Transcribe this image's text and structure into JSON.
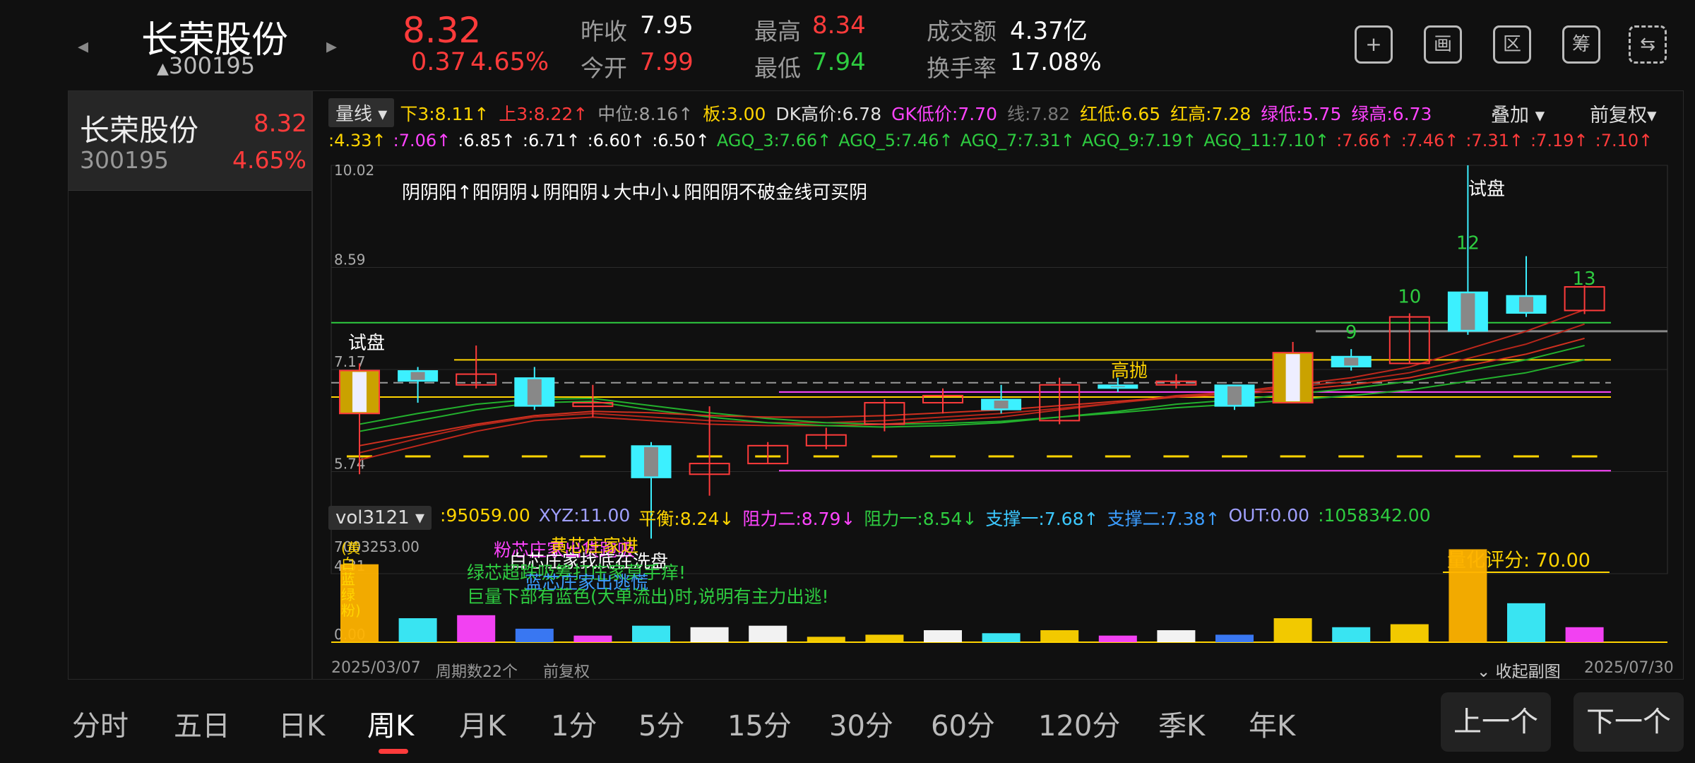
{
  "header": {
    "stock_name": "长荣股份",
    "stock_code": "300195",
    "price": "8.32",
    "change": "0.37",
    "change_pct": "4.65%",
    "prev_close_label": "昨收",
    "prev_close": "7.95",
    "open_label": "今开",
    "open": "7.99",
    "high_label": "最高",
    "high": "8.34",
    "low_label": "最低",
    "low": "7.94",
    "turnover_amt_label": "成交额",
    "turnover_amt": "4.37亿",
    "turnover_rate_label": "换手率",
    "turnover_rate": "17.08%",
    "tools": [
      {
        "icon": "plus-icon",
        "glyph": "+"
      },
      {
        "icon": "draw-icon",
        "glyph": "画"
      },
      {
        "icon": "range-icon",
        "glyph": "区"
      },
      {
        "icon": "chip-icon",
        "glyph": "筹"
      },
      {
        "icon": "landscape-icon",
        "glyph": "⇆"
      }
    ]
  },
  "side": {
    "name": "长荣股份",
    "price": "8.32",
    "code": "300195",
    "pct": "4.65%"
  },
  "indicator1": {
    "dropdown": "量线",
    "items": [
      {
        "text": "下3:8.11↑",
        "color": "#ffd400"
      },
      {
        "text": "上3:8.22↑",
        "color": "#ff3b3b"
      },
      {
        "text": "中位:8.16↑",
        "color": "#a0a0a0"
      },
      {
        "text": "板:3.00",
        "color": "#ffd400"
      },
      {
        "text": "DK高价:6.78",
        "color": "#e0e0e0"
      },
      {
        "text": "GK低价:7.70",
        "color": "#ff44ff"
      },
      {
        "text": "线:7.82",
        "color": "#777777"
      },
      {
        "text": "红低:6.65",
        "color": "#ffd400"
      },
      {
        "text": "红高:7.28",
        "color": "#ffd400"
      },
      {
        "text": "绿低:5.75",
        "color": "#ff44ff"
      },
      {
        "text": "绿高:6.73",
        "color": "#ff44ff"
      }
    ],
    "overlay": "叠加",
    "adjust": "前复权"
  },
  "indicator2": [
    {
      "text": ":4.33↑",
      "color": "#ffd400"
    },
    {
      "text": ":7.06↑",
      "color": "#ff44ff"
    },
    {
      "text": ":6.85↑",
      "color": "#ffffff"
    },
    {
      "text": ":6.71↑",
      "color": "#ffffff"
    },
    {
      "text": ":6.60↑",
      "color": "#ffffff"
    },
    {
      "text": ":6.50↑",
      "color": "#ffffff"
    },
    {
      "text": "AGQ_3:7.66↑",
      "color": "#2ecc40"
    },
    {
      "text": "AGQ_5:7.46↑",
      "color": "#2ecc40"
    },
    {
      "text": "AGQ_7:7.31↑",
      "color": "#2ecc40"
    },
    {
      "text": "AGQ_9:7.19↑",
      "color": "#2ecc40"
    },
    {
      "text": "AGQ_11:7.10↑",
      "color": "#2ecc40"
    },
    {
      "text": ":7.66↑",
      "color": "#ff3b3b"
    },
    {
      "text": ":7.46↑",
      "color": "#ff3b3b"
    },
    {
      "text": ":7.31↑",
      "color": "#ff3b3b"
    },
    {
      "text": ":7.19↑",
      "color": "#ff3b3b"
    },
    {
      "text": ":7.10↑",
      "color": "#ff3b3b"
    }
  ],
  "main_chart": {
    "y_ticks": [
      "10.02",
      "8.59",
      "7.17",
      "5.74",
      "4.31"
    ],
    "pattern_note": "阴阴阳↑阳阴阴↓阴阳阴↓大中小↓阳阳阴不破金线可买阴",
    "label_trial_left": "试盘",
    "label_trial_right": "试盘",
    "label_high_sell": "高抛",
    "numbers": [
      "9",
      "10",
      "12",
      "13"
    ],
    "score": "量化评分: 70.00",
    "colors": {
      "up": "#ff3b3b",
      "down": "#3cf0ff",
      "ma_red": "#c0281c",
      "ma_green": "#23b12d",
      "gold": "#ffd400",
      "magenta": "#ff44ff"
    }
  },
  "chart_data": {
    "type": "candlestick",
    "period": "周K",
    "x_start": "2025/03/07",
    "x_end": "2025/07/30",
    "ylim": [
      4.31,
      10.02
    ],
    "candles": [
      {
        "o": 6.55,
        "c": 7.15,
        "h": 7.25,
        "l": 5.7
      },
      {
        "o": 7.15,
        "c": 7.0,
        "h": 7.2,
        "l": 6.7
      },
      {
        "o": 6.95,
        "c": 7.1,
        "h": 7.5,
        "l": 6.9
      },
      {
        "o": 7.05,
        "c": 6.65,
        "h": 7.2,
        "l": 6.6
      },
      {
        "o": 6.65,
        "c": 6.7,
        "h": 6.95,
        "l": 6.5
      },
      {
        "o": 6.1,
        "c": 5.65,
        "h": 6.15,
        "l": 4.8
      },
      {
        "o": 5.7,
        "c": 5.85,
        "h": 6.65,
        "l": 5.4
      },
      {
        "o": 5.85,
        "c": 6.1,
        "h": 6.15,
        "l": 5.85
      },
      {
        "o": 6.1,
        "c": 6.25,
        "h": 6.35,
        "l": 6.05
      },
      {
        "o": 6.4,
        "c": 6.7,
        "h": 6.75,
        "l": 6.3
      },
      {
        "o": 6.7,
        "c": 6.8,
        "h": 6.9,
        "l": 6.55
      },
      {
        "o": 6.75,
        "c": 6.6,
        "h": 6.95,
        "l": 6.55
      },
      {
        "o": 6.45,
        "c": 6.95,
        "h": 7.05,
        "l": 6.4
      },
      {
        "o": 6.95,
        "c": 6.9,
        "h": 7.05,
        "l": 6.85
      },
      {
        "o": 6.95,
        "c": 7.0,
        "h": 7.1,
        "l": 6.9
      },
      {
        "o": 6.95,
        "c": 6.65,
        "h": 6.95,
        "l": 6.6
      },
      {
        "o": 6.7,
        "c": 7.4,
        "h": 7.55,
        "l": 6.7
      },
      {
        "o": 7.35,
        "c": 7.2,
        "h": 7.45,
        "l": 7.15
      },
      {
        "o": 7.25,
        "c": 7.9,
        "h": 7.95,
        "l": 7.25
      },
      {
        "o": 8.25,
        "c": 7.7,
        "h": 10.02,
        "l": 7.65
      },
      {
        "o": 8.2,
        "c": 7.95,
        "h": 8.75,
        "l": 7.9
      },
      {
        "o": 7.99,
        "c": 8.32,
        "h": 8.34,
        "l": 7.94
      }
    ],
    "volume": [
      2.6,
      0.8,
      0.9,
      0.45,
      0.22,
      0.55,
      0.5,
      0.55,
      0.18,
      0.25,
      0.4,
      0.3,
      0.4,
      0.22,
      0.4,
      0.25,
      0.8,
      0.5,
      0.6,
      3.1,
      1.3,
      0.5
    ],
    "vol_colors": [
      "#ffb300",
      "#3cf0ff",
      "#ff44ff",
      "#3c7dff",
      "#ff44ff",
      "#3cf0ff",
      "#ffffff",
      "#ffffff",
      "#ffd400",
      "#ffd400",
      "#ffffff",
      "#3cf0ff",
      "#ffd400",
      "#ff44ff",
      "#ffffff",
      "#3c7dff",
      "#ffd400",
      "#3cf0ff",
      "#ffd400",
      "#ffb300",
      "#3cf0ff",
      "#ff44ff"
    ]
  },
  "indicator_vol": {
    "dropdown": "vol3121",
    "items": [
      {
        "text": ":95059.00",
        "color": "#ffd400"
      },
      {
        "text": "XYZ:11.00",
        "color": "#a0a0ff"
      },
      {
        "text": "平衡:8.24↓",
        "color": "#ffd400"
      },
      {
        "text": "阻力二:8.79↓",
        "color": "#ff44ff"
      },
      {
        "text": "阻力一:8.54↓",
        "color": "#2ecc40"
      },
      {
        "text": "支撑一:7.68↑",
        "color": "#3cc8ff"
      },
      {
        "text": "支撑二:7.38↑",
        "color": "#3c9dff"
      },
      {
        "text": "OUT:0.00",
        "color": "#a0a0ff"
      },
      {
        "text": ":1058342.00",
        "color": "#2ecc40"
      }
    ],
    "y_top": "7003253.00",
    "y_zero": "0.00",
    "notes": [
      {
        "text": "粉芯庄家出货跑吸",
        "color": "#ff44ff"
      },
      {
        "text": "黄芯庄家进",
        "color": "#ffd400"
      },
      {
        "text": "白芯庄家找底在洗盘",
        "color": "#ffffff"
      },
      {
        "text": "绿芯超跌吸筹打庄家莫手痒!",
        "color": "#2ecc40"
      },
      {
        "text": "蓝芯庄家出逃慌",
        "color": "#3c9dff"
      },
      {
        "text": "巨量下部有蓝色(大单流出)时,说明有主力出逃!",
        "color": "#2ecc40"
      }
    ],
    "legend_stack": [
      "(黄",
      "白",
      "蓝",
      "绿",
      "粉)"
    ]
  },
  "footer_axis": {
    "start_date": "2025/03/07",
    "periods": "周期数22个",
    "adjust": "前复权",
    "collapse": "收起副图",
    "end_date": "2025/07/30"
  },
  "tabs": [
    "分时",
    "五日",
    "日K",
    "周K",
    "月K",
    "1分",
    "5分",
    "15分",
    "30分",
    "60分",
    "120分",
    "季K",
    "年K"
  ],
  "active_tab": "周K",
  "nav": {
    "prev": "上一个",
    "next": "下一个"
  }
}
